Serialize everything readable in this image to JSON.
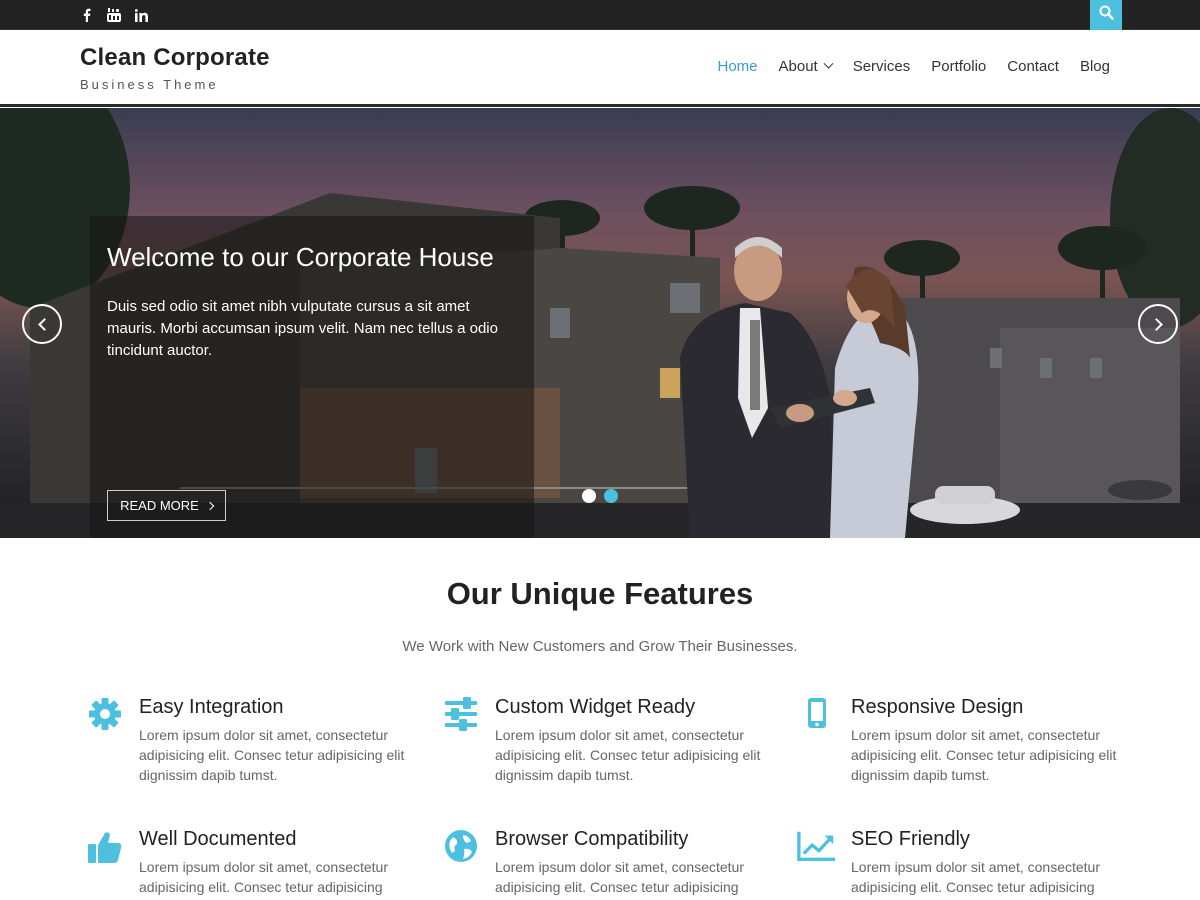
{
  "topbar": {
    "social": [
      {
        "icon": "facebook-icon",
        "glyph": "f"
      },
      {
        "icon": "youtube-icon",
        "glyph": "You"
      },
      {
        "icon": "linkedin-icon",
        "glyph": "in"
      }
    ],
    "search_icon": "search-icon",
    "accent": "#4ec0df"
  },
  "header": {
    "site_title": "Clean Corporate",
    "tagline": "Business Theme",
    "nav": [
      {
        "label": "Home",
        "active": true
      },
      {
        "label": "About",
        "has_dropdown": true
      },
      {
        "label": "Services"
      },
      {
        "label": "Portfolio"
      },
      {
        "label": "Contact"
      },
      {
        "label": "Blog"
      }
    ],
    "active_color": "#3a9ccc"
  },
  "hero": {
    "title": "Welcome to our Corporate House",
    "text": "Duis sed odio sit amet nibh vulputate cursus a sit amet mauris. Morbi accumsan ipsum velit. Nam nec tellus a odio tincidunt auctor.",
    "button": "READ MORE",
    "prev_icon": "chevron-left-icon",
    "next_icon": "chevron-right-icon",
    "slide_count": 2,
    "active_slide": 2
  },
  "features": {
    "title": "Our Unique Features",
    "subtitle": "We Work with New Customers and Grow Their Businesses.",
    "icon_color": "#4ec0df",
    "items": [
      {
        "title": "Easy Integration",
        "icon": "gear-icon",
        "text": "Lorem ipsum dolor sit amet, consectetur adipisicing elit. Consec tetur adipisicing elit dignissim dapib tumst."
      },
      {
        "title": "Custom Widget Ready",
        "icon": "sliders-icon",
        "text": "Lorem ipsum dolor sit amet, consectetur adipisicing elit. Consec tetur adipisicing elit dignissim dapib tumst."
      },
      {
        "title": "Responsive Design",
        "icon": "mobile-icon",
        "text": "Lorem ipsum dolor sit amet, consectetur adipisicing elit. Consec tetur adipisicing elit dignissim dapib tumst."
      },
      {
        "title": "Well Documented",
        "icon": "thumbs-up-icon",
        "text": "Lorem ipsum dolor sit amet, consectetur adipisicing elit. Consec tetur adipisicing"
      },
      {
        "title": "Browser Compatibility",
        "icon": "globe-icon",
        "text": "Lorem ipsum dolor sit amet, consectetur adipisicing elit. Consec tetur adipisicing"
      },
      {
        "title": "SEO Friendly",
        "icon": "chart-line-icon",
        "text": "Lorem ipsum dolor sit amet, consectetur adipisicing elit. Consec tetur adipisicing"
      }
    ]
  }
}
